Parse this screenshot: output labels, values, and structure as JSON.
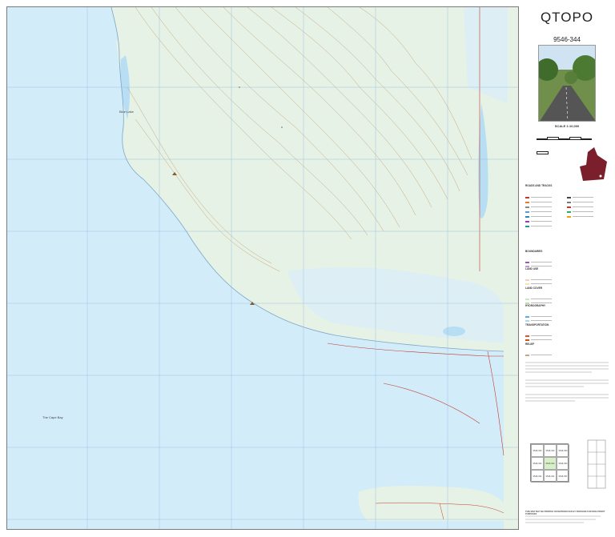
{
  "brand": "QTOPO",
  "sheet_number": "9546-344",
  "scale": "SCALE 1:10,000",
  "map": {
    "place_labels": [
      "Blue Lake",
      "The Cape Bay"
    ],
    "colors": {
      "water": "#d3ecfa",
      "land": "#e6f2e6",
      "contour": "#c7a67a",
      "road": "#c0392b",
      "grid": "#8fb7d9"
    }
  },
  "grid_index": [
    "9546-333",
    "9546-343",
    "9546-353",
    "9546-334",
    "9546-344",
    "9546-354",
    "9546-331",
    "9546-341",
    "9546-351"
  ],
  "legend": {
    "sections": [
      "ROADS AND TRACKS",
      "BOUNDARIES",
      "LAND USE",
      "LAND COVER",
      "HYDROGRAPHY",
      "TRANSPORTATION",
      "RELIEF"
    ]
  },
  "footer": {
    "print_note": "THIS MAP MAY BE PRINTED OR REPRODUCED BY PERSONS FOR NON-PROFIT PURPOSES"
  }
}
